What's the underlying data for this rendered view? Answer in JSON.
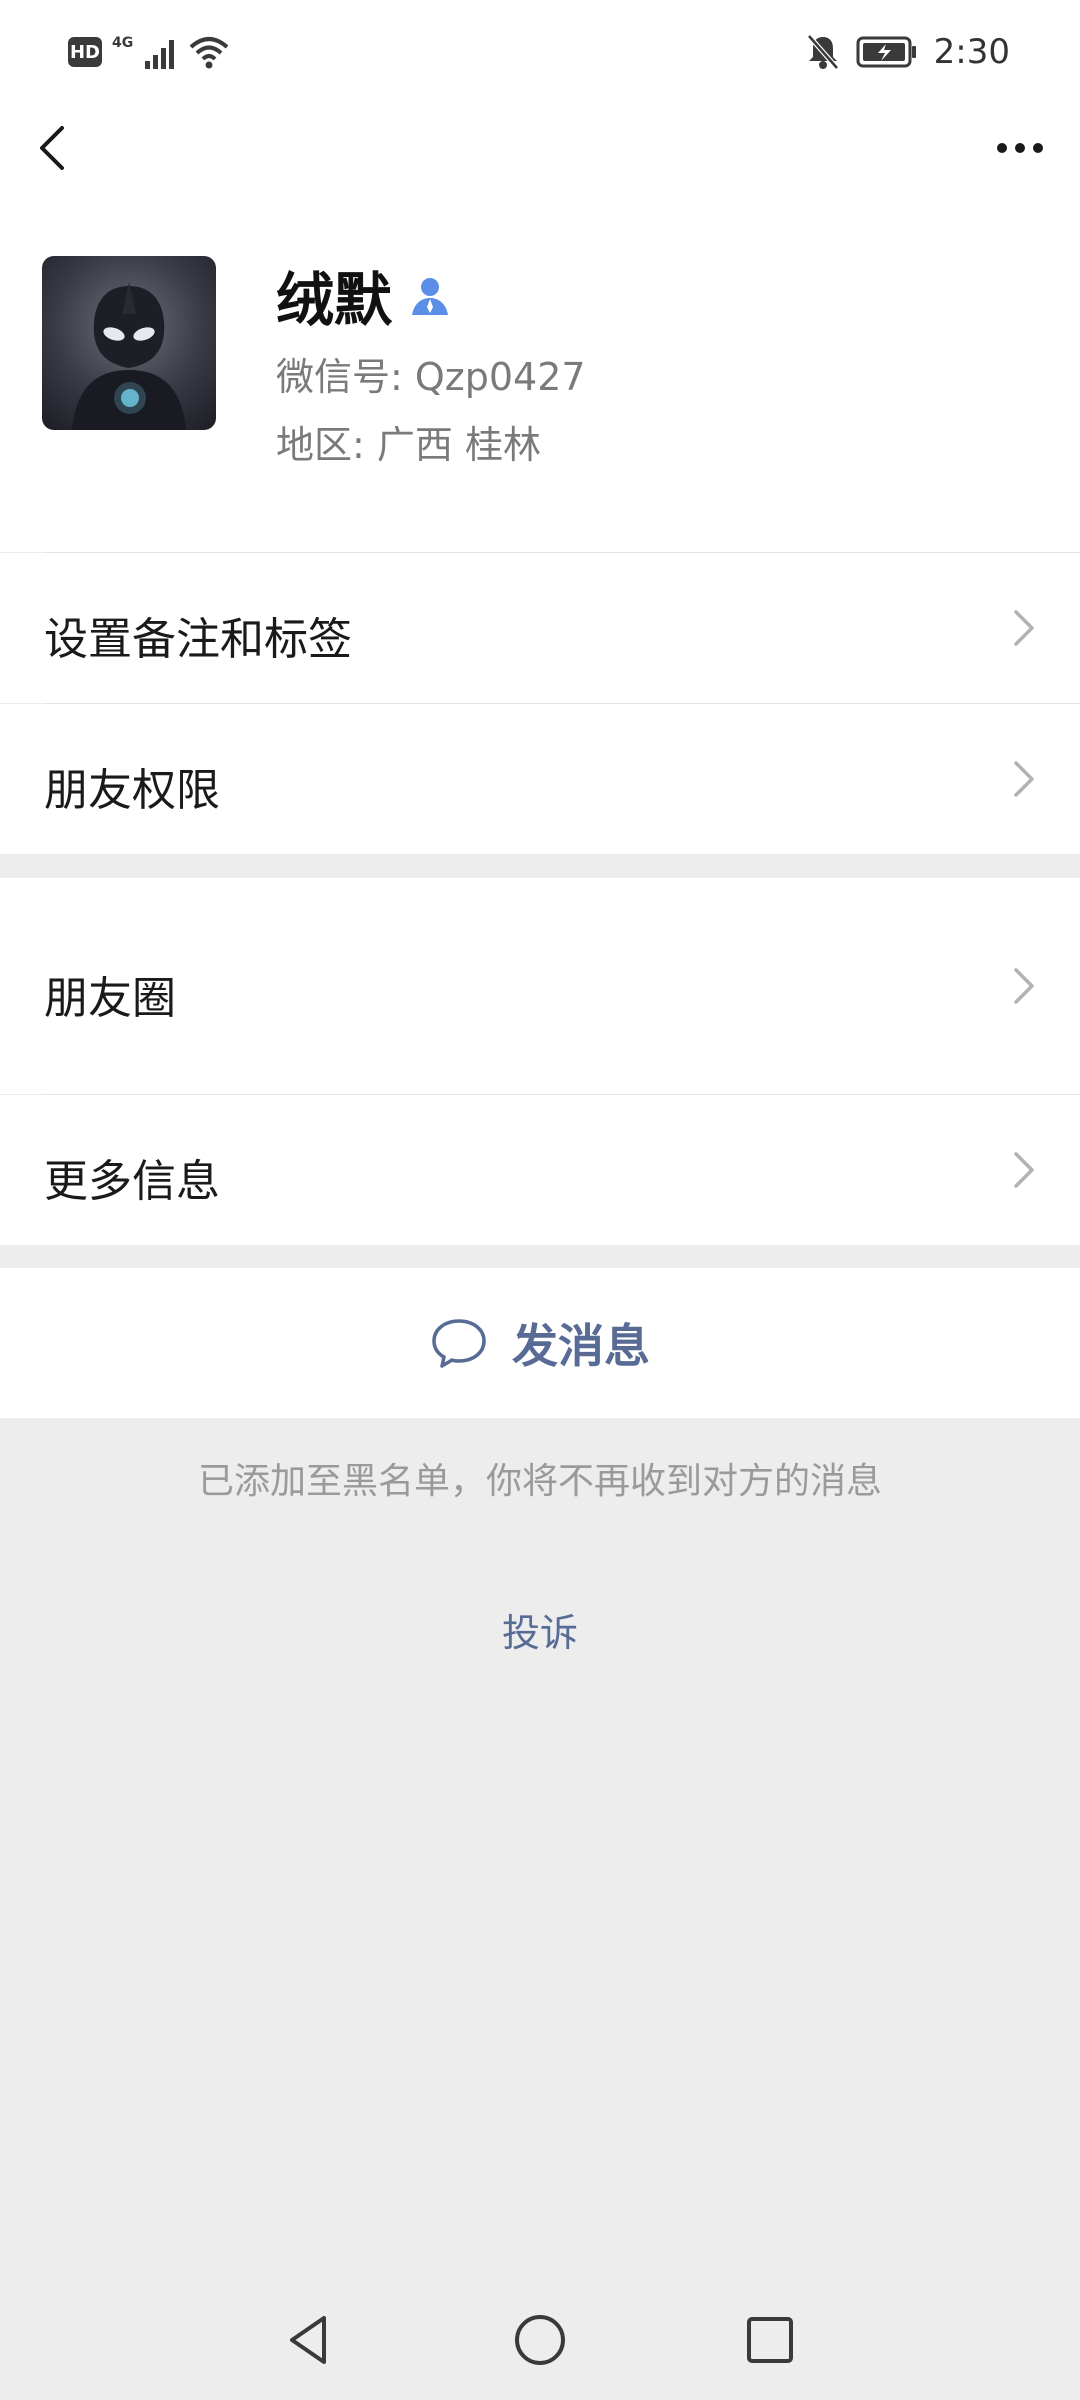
{
  "status_bar": {
    "left_badges": [
      "HD",
      "4G"
    ],
    "time": "2:30"
  },
  "header": {
    "back_icon": "chevron-left-icon",
    "more_icon": "more-dots-icon"
  },
  "profile": {
    "name": "绒默",
    "wechat_id": "微信号: Qzp0427",
    "region": "地区: 广西  桂林",
    "badge_icon": "person-icon",
    "badge_color": "#5b8ee6"
  },
  "menu": {
    "remark_tags": "设置备注和标签",
    "friend_permissions": "朋友权限",
    "moments": "朋友圈",
    "more_info": "更多信息"
  },
  "actions": {
    "send_message": "发消息",
    "send_icon": "chat-bubble-icon"
  },
  "notice": {
    "blacklist": "已添加至黑名单，你将不再收到对方的消息",
    "report": "投诉"
  },
  "colors": {
    "link": "#576b95",
    "background": "#ededed",
    "surface": "#ffffff"
  }
}
